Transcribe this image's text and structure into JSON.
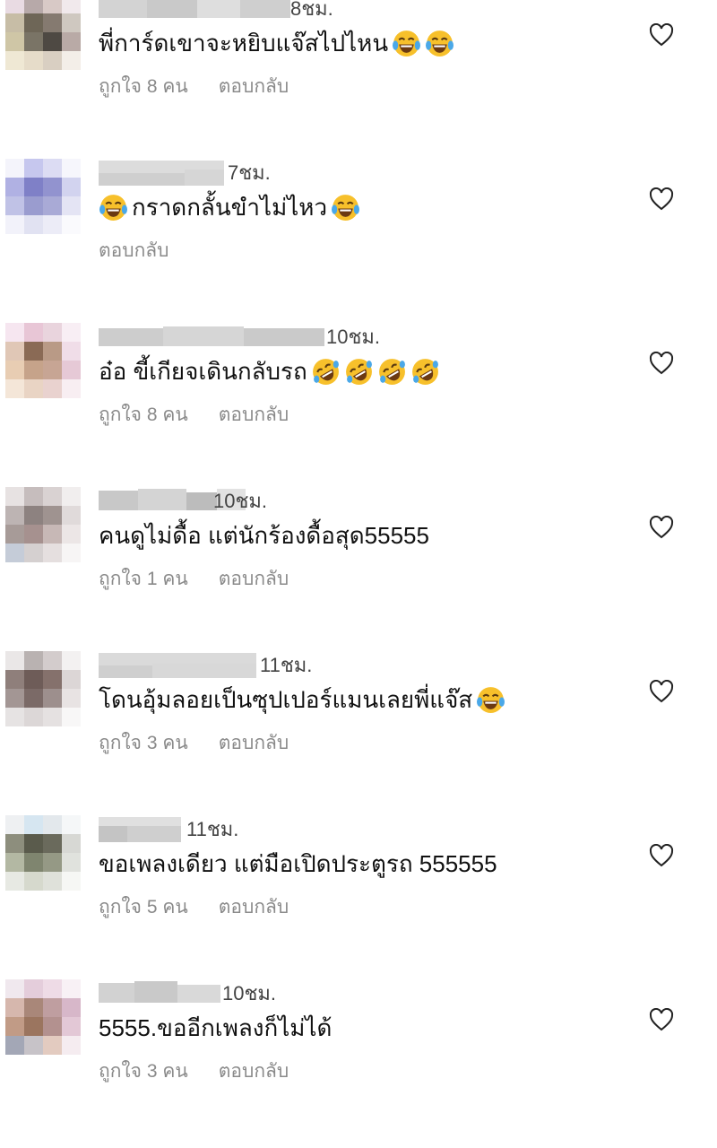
{
  "comments": [
    {
      "time": "8ชม.",
      "text": "พี่การ์ดเขาจะหยิบแจ๊สไปไหน",
      "emoji": [
        "laugh-tears",
        "laugh-tears"
      ],
      "likes": "ถูกใจ 8 คน",
      "reply": "ตอบกลับ"
    },
    {
      "time": "7ชม.",
      "text_pre": "",
      "text": "กราดกลั้นขำไม่ไหว",
      "emoji_pre": [
        "laugh-tears"
      ],
      "emoji": [
        "laugh-tears"
      ],
      "likes": "",
      "reply": "ตอบกลับ"
    },
    {
      "time": "10ชม.",
      "text": "อ๋อ ขี้เกียจเดินกลับรถ",
      "emoji": [
        "rofl",
        "rofl",
        "rofl",
        "rofl"
      ],
      "likes": "ถูกใจ 8 คน",
      "reply": "ตอบกลับ"
    },
    {
      "time": "10ชม.",
      "text": "คนดูไม่ดื้อ แต่นักร้องดื้อสุด55555",
      "emoji": [],
      "likes": "ถูกใจ 1 คน",
      "reply": "ตอบกลับ"
    },
    {
      "time": "11ชม.",
      "text": "โดนอุ้มลอยเป็นซุปเปอร์แมนเลยพี่แจ๊ส",
      "emoji": [
        "laugh-tears"
      ],
      "likes": "ถูกใจ 3 คน",
      "reply": "ตอบกลับ"
    },
    {
      "time": "11ชม.",
      "text": "ขอเพลงเดียว แต่มือเปิดประตูรถ 555555",
      "emoji": [],
      "likes": "ถูกใจ 5 คน",
      "reply": "ตอบกลับ"
    },
    {
      "time": "10ชม.",
      "text": "5555.ขออีกเพลงก็ไม่ได้",
      "emoji": [],
      "likes": "ถูกใจ 3 คน",
      "reply": "ตอบกลับ"
    }
  ],
  "icons": {
    "like": "heart-outline-icon",
    "laugh": "face-with-tears-of-joy-emoji",
    "rofl": "rolling-on-floor-laughing-emoji"
  },
  "colors": {
    "meta": "#8a8a8a",
    "emoji_face": "#f7c02b",
    "tears": "#4aa8e8"
  }
}
